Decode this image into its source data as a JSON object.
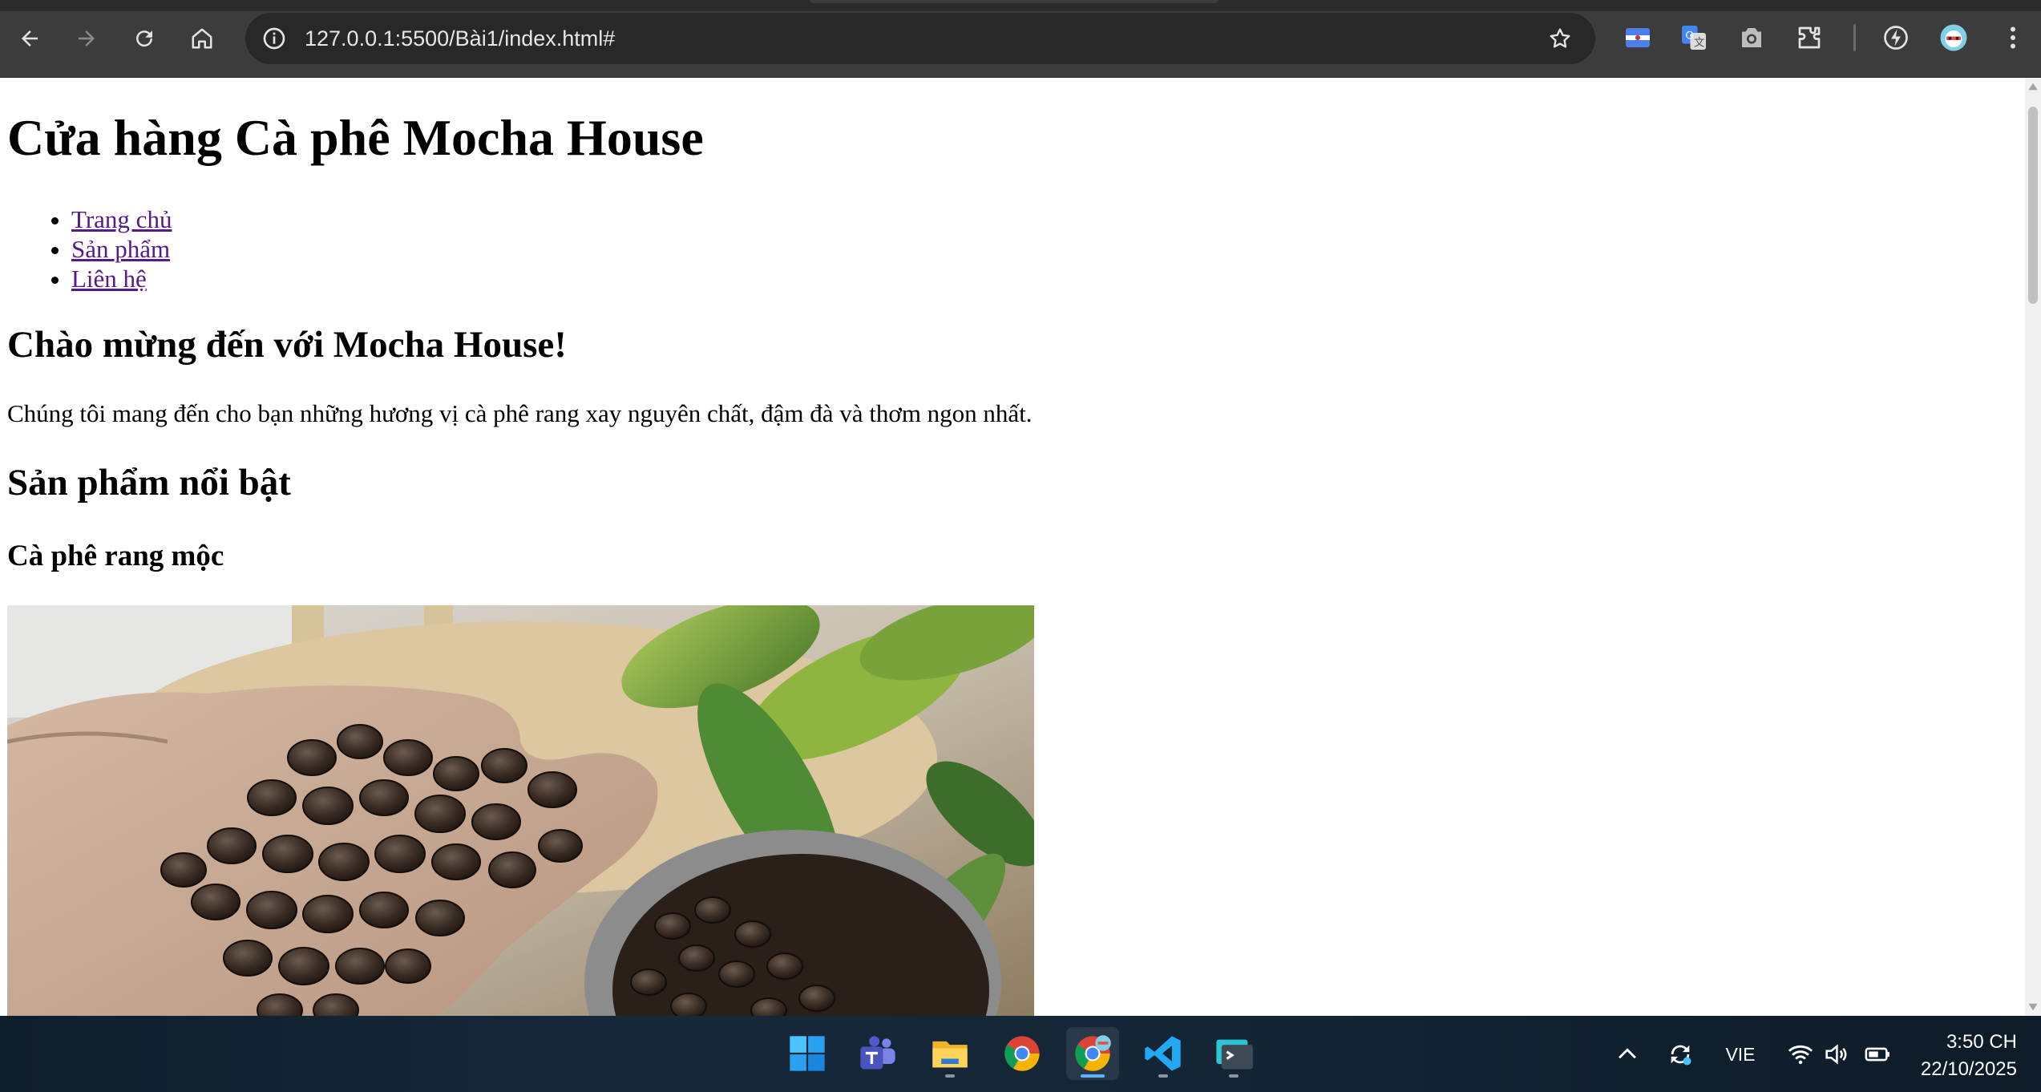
{
  "browser": {
    "url": "127.0.0.1:5500/Bài1/index.html#"
  },
  "page": {
    "title": "Cửa hàng Cà phê Mocha House",
    "nav": [
      {
        "label": "Trang chủ"
      },
      {
        "label": "Sản phẩm"
      },
      {
        "label": "Liên hệ"
      }
    ],
    "welcome_heading": "Chào mừng đến với Mocha House!",
    "welcome_text": "Chúng tôi mang đến cho bạn những hương vị cà phê rang xay nguyên chất, đậm đà và thơm ngon nhất.",
    "featured_heading": "Sản phẩm nổi bật",
    "product": {
      "name": "Cà phê rang mộc"
    }
  },
  "taskbar": {
    "apps": [
      {
        "icon": "windows-start-icon"
      },
      {
        "icon": "teams-icon"
      },
      {
        "icon": "file-explorer-icon"
      },
      {
        "icon": "chrome-icon"
      },
      {
        "icon": "chrome-profile-icon"
      },
      {
        "icon": "vscode-icon"
      },
      {
        "icon": "terminal-icon"
      }
    ],
    "language": "VIE",
    "time": "3:50 CH",
    "date": "22/10/2025"
  },
  "colors": {
    "chrome_bg": "#3c3c3c",
    "omnibox_bg": "#282828",
    "visited_link": "#551a8b",
    "taskbar_bg": "#13243a"
  }
}
